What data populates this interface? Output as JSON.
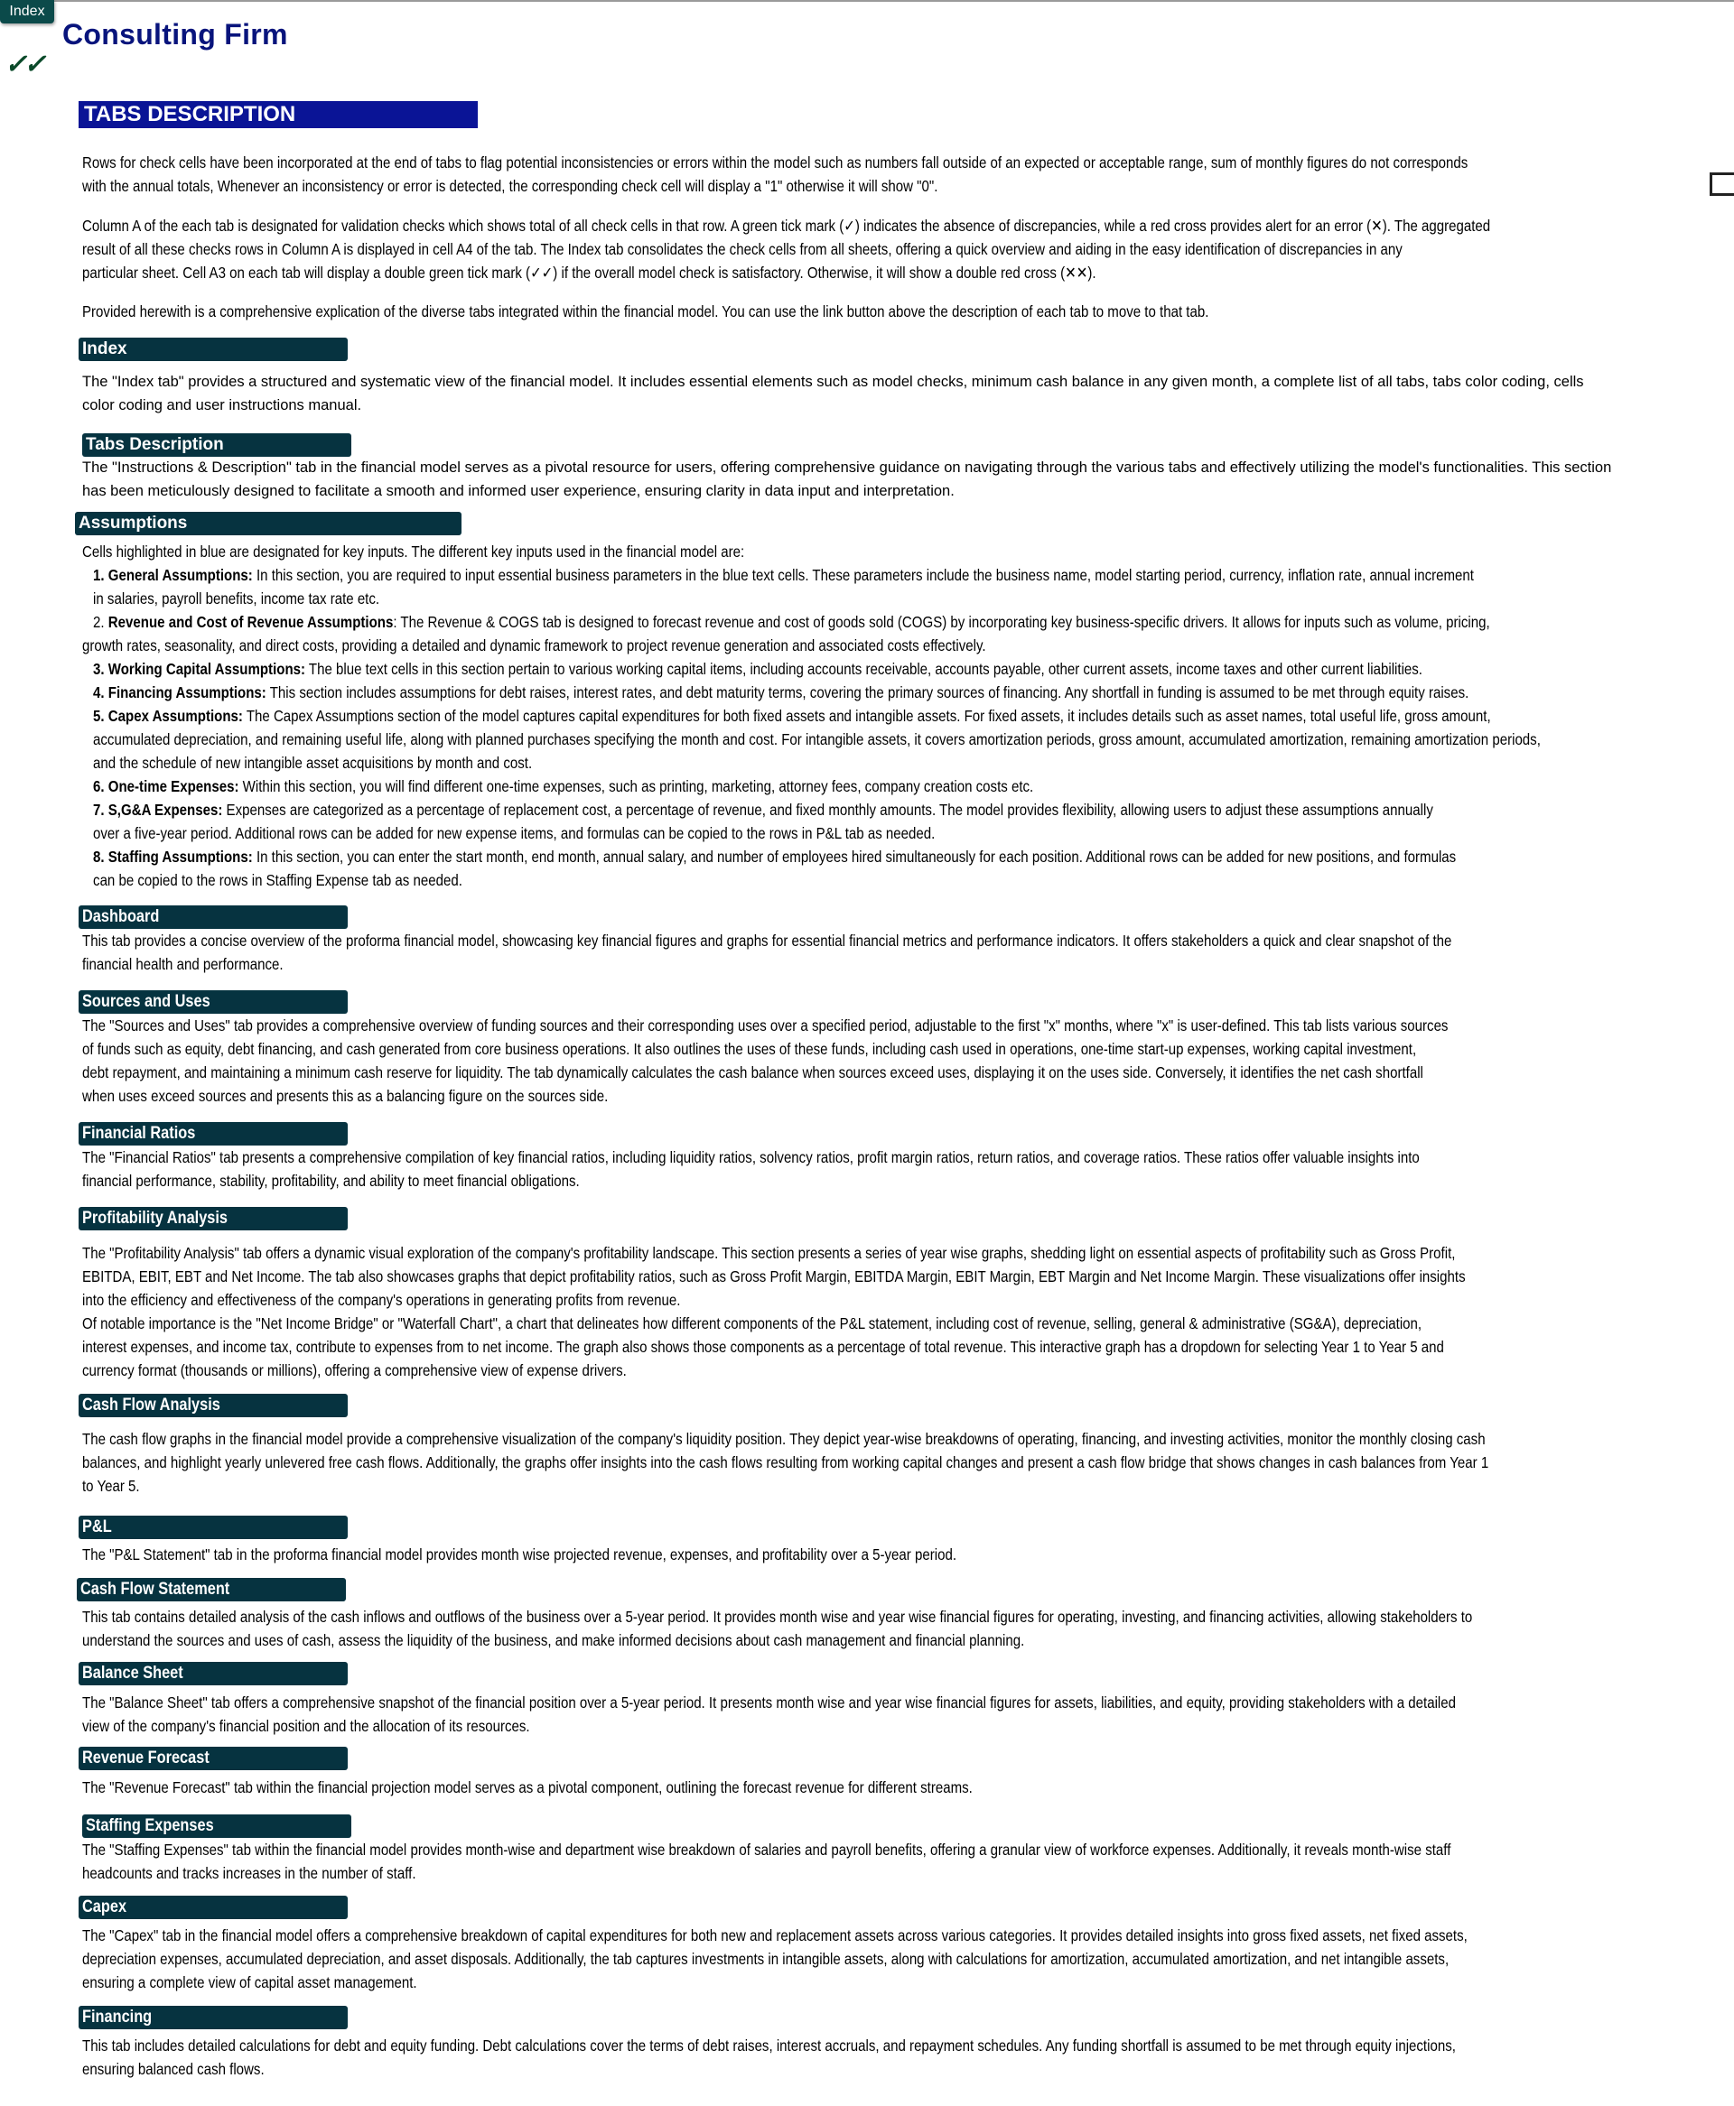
{
  "nav": {
    "index_button": "Index"
  },
  "header": {
    "title": "Consulting Firm",
    "model_check": "✓✓",
    "section_title": "TABS DESCRIPTION"
  },
  "intro": {
    "p1": [
      "Rows for check cells have been incorporated at the end of tabs to flag potential inconsistencies or errors within the model such as numbers fall outside of an expected or acceptable range, sum of monthly figures do not corresponds",
      "with the annual totals, Whenever an inconsistency or error is detected, the corresponding check cell will display a \"1\" otherwise it will show \"0\"."
    ],
    "p2": [
      "Column A of the each tab is designated for validation checks which shows total of all check cells in that row. A green tick mark (✓) indicates the absence of discrepancies, while a red cross provides alert for an error (✕). The aggregated",
      "result of all these checks rows in Column A is displayed in cell A4 of the tab. The Index tab consolidates the check cells from all sheets, offering a quick overview and aiding in the easy identification of discrepancies in any",
      "particular sheet. Cell A3 on each tab will display a double green tick mark (✓✓) if the overall model check is satisfactory.  Otherwise, it will show a double red cross (✕✕)."
    ],
    "p3": [
      "Provided herewith is a comprehensive explication of the diverse tabs integrated within the financial model. You can use the link button above the description of each tab to move to that tab."
    ]
  },
  "sections": {
    "index": {
      "label": "Index",
      "lines": [
        "The \"Index tab\" provides a structured and systematic view of the financial model. It includes essential elements such as model checks, minimum cash balance in any given month, a complete list of all tabs, tabs color coding, cells",
        "color coding and user instructions manual."
      ]
    },
    "tabs_description": {
      "label": "Tabs Description",
      "lines": [
        "The \"Instructions & Description\" tab in the financial model serves as a pivotal resource for users, offering comprehensive guidance on navigating through the various tabs and effectively utilizing the model's functionalities. This section",
        "has been meticulously designed to facilitate a smooth and informed user experience, ensuring clarity in data input and interpretation."
      ]
    },
    "assumptions": {
      "label": "Assumptions",
      "intro": "Cells highlighted in blue are designated for key inputs. The different key inputs used in the financial model are:",
      "items": [
        {
          "title": "1. General Assumptions:",
          "lines": [
            "In this section, you are required to input essential business parameters in the blue text cells. These parameters include the business name, model starting period, currency, inflation rate, annual increment",
            "in salaries, payroll benefits, income tax rate etc."
          ]
        },
        {
          "title": "Revenue and Cost of Revenue Assumptions",
          "prefix": "2. ",
          "lines": [
            ": The Revenue & COGS tab is designed to forecast revenue and cost of goods sold (COGS) by incorporating key business-specific drivers. It allows for inputs such as volume, pricing,",
            "growth rates, seasonality, and direct costs, providing a detailed and dynamic framework to project revenue generation and associated costs effectively."
          ]
        },
        {
          "title": "3. Working Capital Assumptions:",
          "lines": [
            "The blue text cells in this section pertain to various working capital items, including accounts receivable,  accounts payable, other current assets, income taxes and other current liabilities."
          ]
        },
        {
          "title": "4. Financing Assumptions:",
          "lines": [
            "This section includes assumptions for debt raises, interest rates, and debt maturity terms, covering the primary sources of financing. Any shortfall in funding is assumed to be met through equity raises."
          ]
        },
        {
          "title": "5. Capex Assumptions:",
          "lines": [
            "The Capex Assumptions section of the model captures capital expenditures for both fixed assets and intangible assets. For fixed assets, it includes details such as asset names, total useful life, gross amount,",
            "accumulated depreciation, and remaining useful life, along with planned purchases specifying the month and cost. For intangible assets, it covers amortization periods, gross amount, accumulated amortization, remaining amortization periods,",
            "and the schedule of new intangible asset acquisitions by month and cost."
          ]
        },
        {
          "title": "6. One-time Expenses:",
          "lines": [
            "Within this section, you will find different one-time expenses, such as printing, marketing, attorney fees, company creation costs etc."
          ]
        },
        {
          "title": "7. S,G&A Expenses:",
          "lines": [
            " Expenses are categorized as a percentage of replacement cost, a percentage of revenue, and fixed monthly amounts. The model provides flexibility, allowing users to adjust these assumptions annually",
            "over a five-year period. Additional rows can be added for new expense items, and formulas can be copied to the rows in  P&L tab as needed."
          ]
        },
        {
          "title": "8. Staffing Assumptions:",
          "lines": [
            "In this section, you can enter the start month, end month, annual salary, and number of employees hired simultaneously for each position. Additional rows can be added for new positions, and formulas",
            "can be copied to the rows in Staffing Expense tab as needed."
          ]
        }
      ]
    },
    "dashboard": {
      "label": "Dashboard",
      "lines": [
        "This tab provides a concise overview of the proforma financial model, showcasing key financial figures and graphs for essential financial metrics and performance indicators. It offers stakeholders a quick and clear snapshot of the",
        "financial health and performance."
      ]
    },
    "sources_uses": {
      "label": "Sources and Uses",
      "lines": [
        "The \"Sources and Uses\" tab provides a comprehensive overview of funding sources and their corresponding uses over a specified period, adjustable to the first \"x\" months, where \"x\" is user-defined. This tab lists various sources",
        "of funds such as equity, debt financing, and cash generated from core business operations. It also outlines the uses of these funds, including cash used in operations, one-time start-up expenses, working capital investment,",
        "debt repayment, and maintaining  a minimum cash reserve for liquidity. The tab dynamically calculates the cash balance when sources exceed uses, displaying it on the uses side. Conversely, it identifies the net cash shortfall",
        "when uses exceed sources and presents this as a balancing figure on the sources side."
      ]
    },
    "financial_ratios": {
      "label": "Financial Ratios",
      "lines": [
        "The \"Financial Ratios\" tab presents a comprehensive compilation of key financial ratios, including liquidity ratios, solvency ratios, profit margin ratios, return ratios, and coverage ratios. These ratios offer valuable insights into",
        "financial performance, stability, profitability, and ability to meet financial obligations."
      ]
    },
    "profitability": {
      "label": "Profitability Analysis",
      "lines": [
        "The \"Profitability Analysis\" tab offers a dynamic visual exploration of the company's profitability landscape. This section presents a series of year wise graphs, shedding light on essential aspects of profitability such as Gross Profit,",
        "EBITDA, EBIT, EBT and Net Income. The tab also showcases graphs that depict profitability ratios, such as Gross Profit Margin, EBITDA Margin, EBIT Margin, EBT Margin and Net Income Margin. These visualizations offer insights",
        "into the efficiency and effectiveness of the company's operations in generating profits from revenue.",
        "Of notable importance is the \"Net Income Bridge\" or \"Waterfall Chart\", a chart that delineates how different components of the P&L statement, including cost of revenue, selling, general & administrative (SG&A), depreciation,",
        "interest expenses, and income tax, contribute to expenses from to net income. The graph also shows those components as a percentage of total revenue. This interactive graph has a dropdown for selecting Year 1 to Year 5 and",
        "currency format (thousands or millions), offering a comprehensive view of expense drivers."
      ]
    },
    "cash_flow_analysis": {
      "label": "Cash Flow Analysis",
      "lines": [
        "The cash flow graphs in the financial model provide a comprehensive visualization of the company's liquidity position. They depict year-wise breakdowns of operating, financing, and investing activities, monitor the monthly closing cash",
        "balances, and highlight yearly unlevered free cash flows. Additionally, the graphs offer insights into the cash flows resulting from working capital changes and present a cash flow bridge that shows changes in cash balances from Year 1",
        "to Year 5."
      ]
    },
    "pl": {
      "label": "P&L",
      "lines": [
        "The \"P&L Statement\" tab in the proforma financial model provides month wise projected revenue, expenses, and profitability over a 5-year period."
      ]
    },
    "cash_flow_statement": {
      "label": "Cash Flow Statement",
      "lines": [
        "This tab contains detailed analysis of the cash inflows and outflows of the business over a 5-year period. It provides month wise and year wise financial figures for operating, investing, and financing activities, allowing stakeholders to",
        "understand the sources and uses of cash, assess the liquidity of the business, and make informed decisions about cash management and financial planning."
      ]
    },
    "balance_sheet": {
      "label": "Balance Sheet",
      "lines": [
        "The \"Balance Sheet\" tab offers a comprehensive snapshot of the financial position over a 5-year period. It presents month wise and year wise financial figures for assets, liabilities, and equity, providing stakeholders with a detailed",
        "view of the company's financial position and the allocation of its resources."
      ]
    },
    "revenue_forecast": {
      "label": "Revenue Forecast",
      "lines": [
        "The \"Revenue Forecast\" tab within the financial projection model serves as a pivotal component, outlining the forecast revenue for different streams."
      ]
    },
    "staffing_expenses": {
      "label": "Staffing Expenses",
      "lines": [
        "The \"Staffing Expenses\" tab within the financial model provides month-wise and department wise breakdown of salaries and payroll benefits, offering  a granular view of workforce expenses. Additionally, it reveals month-wise staff",
        "headcounts and tracks increases in the number of staff."
      ]
    },
    "capex": {
      "label": "Capex",
      "lines": [
        "The \"Capex\" tab in the financial model offers a comprehensive breakdown of capital expenditures for both new and replacement assets across various categories. It provides detailed insights into gross fixed assets, net fixed assets,",
        "depreciation expenses, accumulated depreciation, and asset disposals. Additionally, the tab captures investments in intangible assets, along with calculations for amortization, accumulated amortization, and net intangible assets,",
        "ensuring a complete view of capital asset management."
      ]
    },
    "financing": {
      "label": "Financing",
      "lines": [
        "This tab includes detailed calculations for debt and equity funding. Debt calculations cover the terms of debt raises, interest accruals, and repayment schedules. Any funding shortfall is assumed to be met through equity injections,",
        "ensuring balanced cash flows."
      ]
    }
  }
}
